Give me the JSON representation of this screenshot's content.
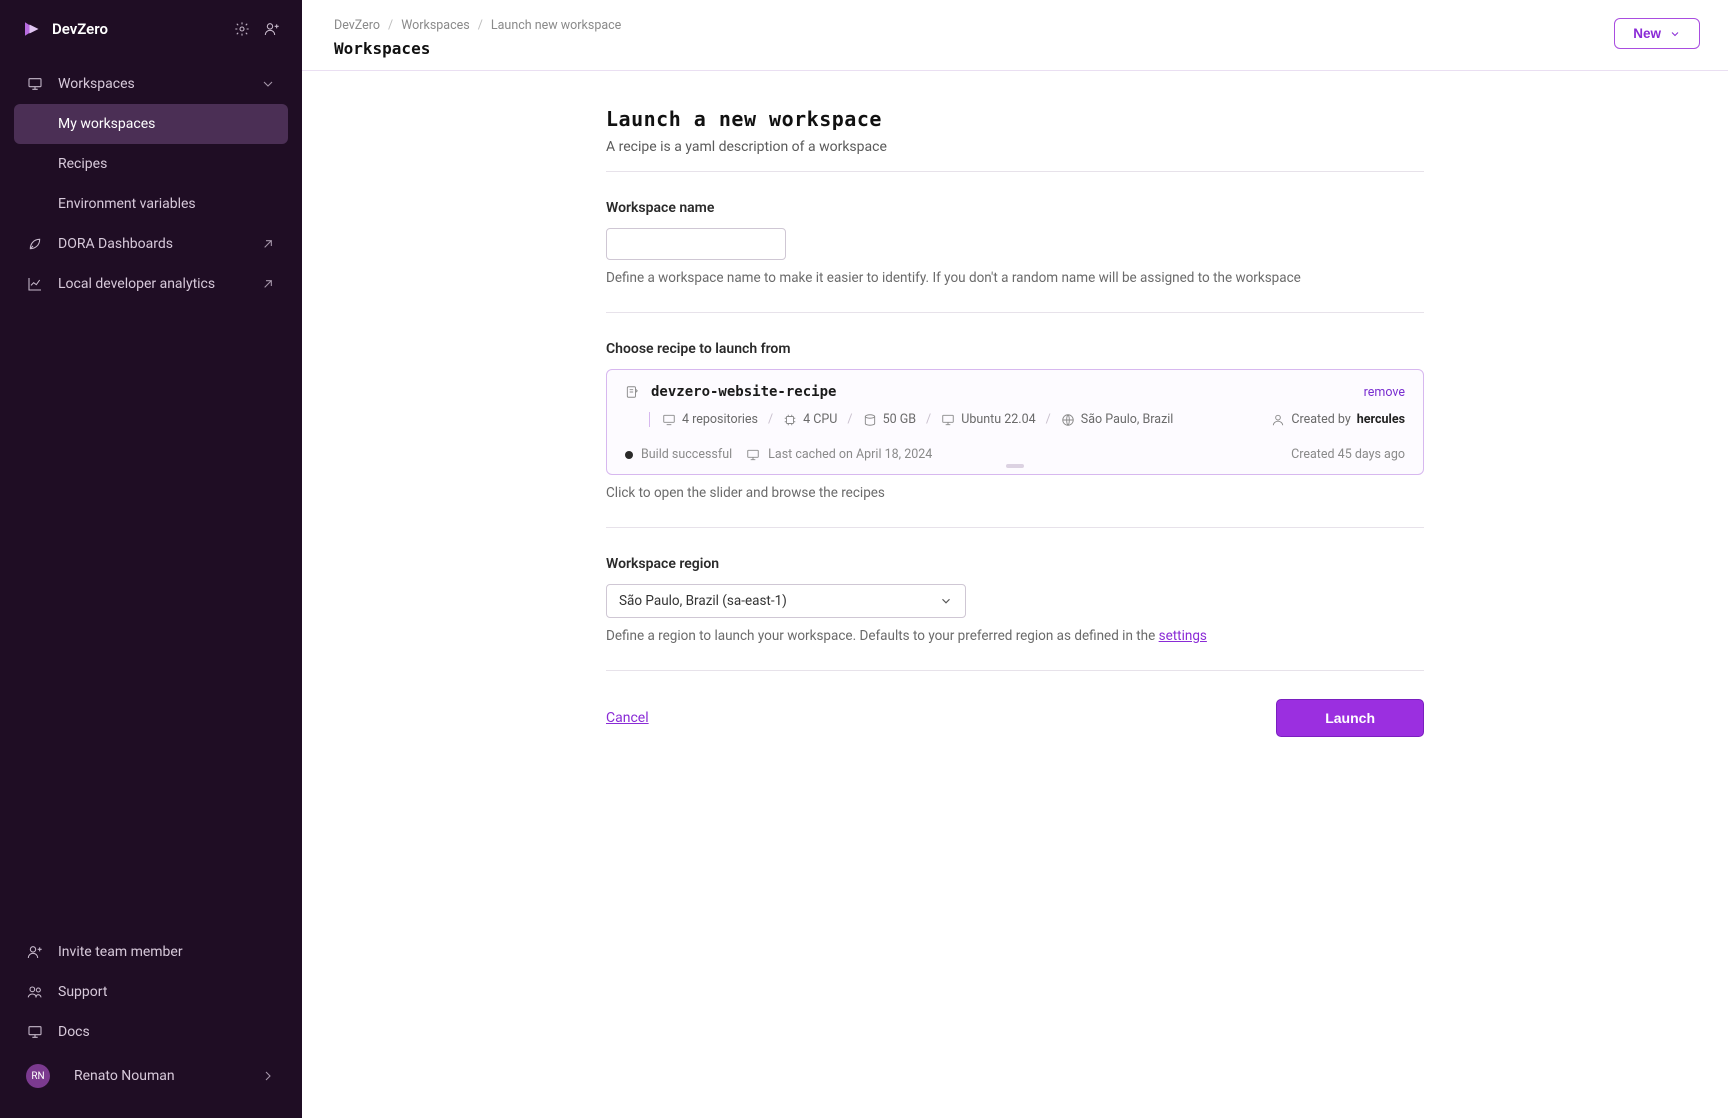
{
  "brand": {
    "name": "DevZero"
  },
  "sidebar": {
    "items": [
      {
        "label": "Workspaces"
      },
      {
        "label": "My workspaces"
      },
      {
        "label": "Recipes"
      },
      {
        "label": "Environment variables"
      },
      {
        "label": "DORA Dashboards"
      },
      {
        "label": "Local developer analytics"
      }
    ],
    "footer": [
      {
        "label": "Invite team member"
      },
      {
        "label": "Support"
      },
      {
        "label": "Docs"
      }
    ],
    "user": {
      "name": "Renato Nouman",
      "initials": "RN"
    }
  },
  "breadcrumb": [
    "DevZero",
    "Workspaces",
    "Launch new workspace"
  ],
  "page_heading": "Workspaces",
  "new_button": "New",
  "form": {
    "title": "Launch a new workspace",
    "subtitle": "A recipe is a yaml description of a workspace",
    "name_label": "Workspace name",
    "name_help": "Define a workspace name to make it easier to identify. If you don't a random name will be assigned to the workspace",
    "recipe_label": "Choose recipe to launch from",
    "recipe_help": "Click to open the slider and browse the recipes",
    "region_label": "Workspace region",
    "region_value": "São Paulo, Brazil (sa-east-1)",
    "region_help_pre": "Define a region to launch your workspace. Defaults to your preferred region as defined in the ",
    "region_help_link": "settings",
    "cancel": "Cancel",
    "launch": "Launch"
  },
  "recipe": {
    "name": "devzero-website-recipe",
    "remove": "remove",
    "repos": "4 repositories",
    "cpu": "4 CPU",
    "disk": "50 GB",
    "os": "Ubuntu 22.04",
    "region": "São Paulo, Brazil",
    "created_by_label": "Created by ",
    "created_by": "hercules",
    "build_status": "Build successful",
    "cached": "Last cached on April 18, 2024",
    "age": "Created 45 days ago"
  }
}
